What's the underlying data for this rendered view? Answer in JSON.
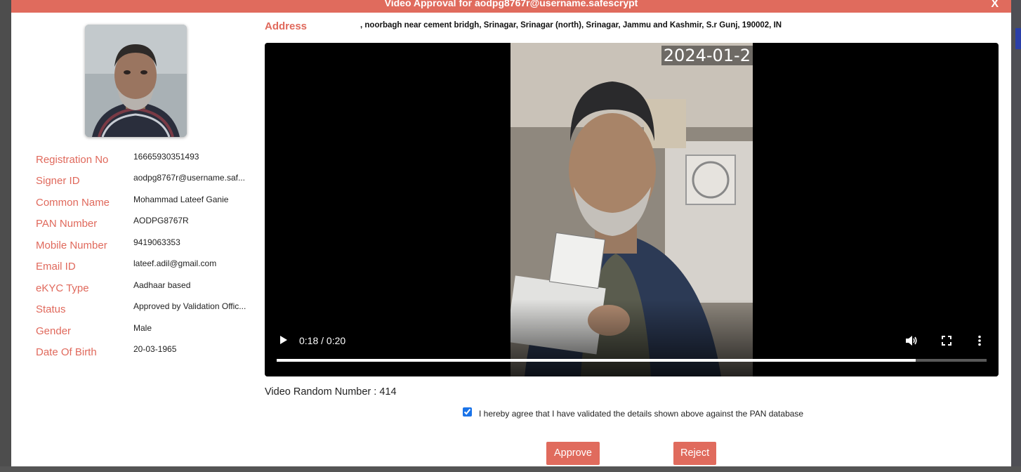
{
  "modal": {
    "title": "Video Approval for aodpg8767r@username.safescrypt",
    "close_label": "X"
  },
  "profile": {
    "photo_icon": "user-photo",
    "fields": [
      {
        "label": "Registration No",
        "value": "16665930351493"
      },
      {
        "label": "Signer ID",
        "value": "aodpg8767r@username.saf..."
      },
      {
        "label": "Common Name",
        "value": "Mohammad Lateef Ganie"
      },
      {
        "label": "PAN Number",
        "value": "AODPG8767R"
      },
      {
        "label": "Mobile Number",
        "value": "9419063353"
      },
      {
        "label": "Email ID",
        "value": "lateef.adil@gmail.com"
      },
      {
        "label": "eKYC Type",
        "value": "Aadhaar based"
      },
      {
        "label": "Status",
        "value": "Approved by Validation Offic..."
      },
      {
        "label": "Gender",
        "value": "Male"
      },
      {
        "label": "Date Of Birth",
        "value": "20-03-1965"
      }
    ]
  },
  "address": {
    "label": "Address",
    "value": ", noorbagh near cement bridgh, Srinagar, Srinagar (north), Srinagar, Jammu and Kashmir, S.r Gunj, 190002, IN"
  },
  "video": {
    "timestamp": "2024-01-2",
    "time_display": "0:18 / 0:20",
    "progress_fraction": 0.9,
    "icons": {
      "play": "play-icon",
      "volume": "volume-icon",
      "fullscreen": "fullscreen-icon",
      "menu": "more-vert-icon"
    }
  },
  "random_number": {
    "label": "Video Random Number",
    "value": "414"
  },
  "agreement": {
    "text": "I hereby agree that I have validated the details shown above against the PAN database",
    "checked": true
  },
  "actions": {
    "approve_label": "Approve",
    "reject_label": "Reject"
  },
  "colors": {
    "accent": "#e06b5d",
    "checkbox": "#1a73e8"
  }
}
